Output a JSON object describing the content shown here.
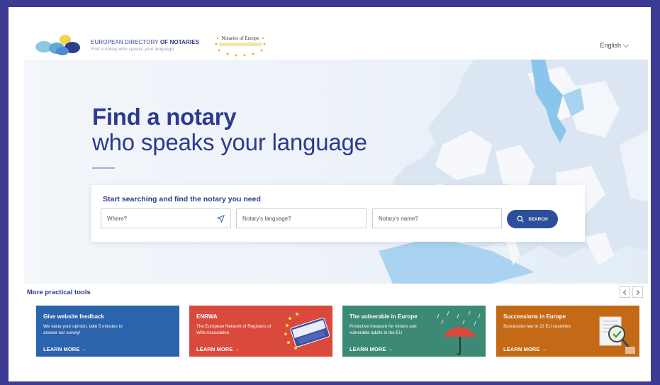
{
  "header": {
    "logo_title_regular": "EUROPEAN DIRECTORY ",
    "logo_title_bold": "OF NOTARIES",
    "logo_subtitle": "Find a notary who speaks your language",
    "partner_title": "Notaries of Europe",
    "language": "English"
  },
  "hero": {
    "title": "Find a notary",
    "subtitle": "who speaks your language"
  },
  "search": {
    "heading": "Start searching and find the notary you need",
    "where_placeholder": "Where?",
    "language_placeholder": "Notary's language?",
    "name_placeholder": "Notary's name?",
    "button_label": "SEARCH"
  },
  "tools": {
    "heading": "More practical tools",
    "cards": [
      {
        "title": "Give website feedback",
        "description": "We value your opinion, take 5 minutes to answer our survey!",
        "link": "LEARN MORE  →",
        "color": "#2b63ad"
      },
      {
        "title": "ENRWA",
        "description": "The European Network of Registers of Wills Association",
        "link": "LEARN MORE  →",
        "color": "#d94a3c"
      },
      {
        "title": "The vulnerable in Europe",
        "description": "Protective measure for minors and vulnerable adults in the EU",
        "link": "LEARN MORE  →",
        "color": "#3c8a76"
      },
      {
        "title": "Successions in Europe",
        "description": "Succession law in 22 EU countries",
        "link": "LEARN MORE  →",
        "color": "#c46a16"
      }
    ]
  },
  "icons": {
    "location": "navigation-arrow-icon",
    "search": "magnifier-icon",
    "prev": "chevron-left-icon",
    "next": "chevron-right-icon"
  }
}
